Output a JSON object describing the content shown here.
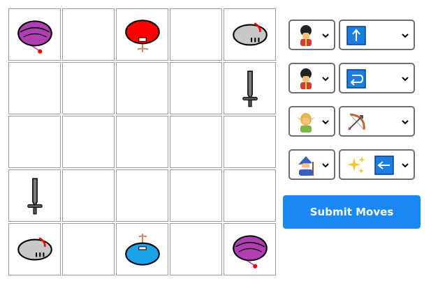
{
  "board": {
    "rows": 5,
    "cols": 5,
    "pieces": [
      {
        "row": 0,
        "col": 0,
        "icon": "purple-hat-icon"
      },
      {
        "row": 0,
        "col": 2,
        "icon": "red-helmet-icon"
      },
      {
        "row": 0,
        "col": 4,
        "icon": "grey-helmet-icon"
      },
      {
        "row": 1,
        "col": 4,
        "icon": "sword-icon"
      },
      {
        "row": 3,
        "col": 0,
        "icon": "sword-icon"
      },
      {
        "row": 4,
        "col": 0,
        "icon": "grey-helmet-icon"
      },
      {
        "row": 4,
        "col": 2,
        "icon": "blue-helmet-icon"
      },
      {
        "row": 4,
        "col": 4,
        "icon": "purple-hat-icon"
      }
    ]
  },
  "moves": [
    {
      "unit_icon": "guard-emoji-icon",
      "unit": "💂",
      "action_icons": [
        "up-arrow-icon"
      ]
    },
    {
      "unit_icon": "guard-emoji-icon",
      "unit": "💂",
      "action_icons": [
        "return-arrow-icon"
      ]
    },
    {
      "unit_icon": "elf-emoji-icon",
      "unit": "🧝",
      "action_icons": [
        "bow-and-arrow-icon"
      ]
    },
    {
      "unit_icon": "mage-emoji-icon",
      "unit": "🧙",
      "action_icons": [
        "sparkles-icon",
        "left-arrow-icon"
      ]
    }
  ],
  "submit_label": "Submit Moves",
  "colors": {
    "submit": "#1a87f2",
    "arrow_box": "#1a7fe0",
    "purple": "#b13fb3",
    "red": "#ff0000",
    "blue": "#1aa3e8",
    "grey": "#c8c8c8"
  }
}
